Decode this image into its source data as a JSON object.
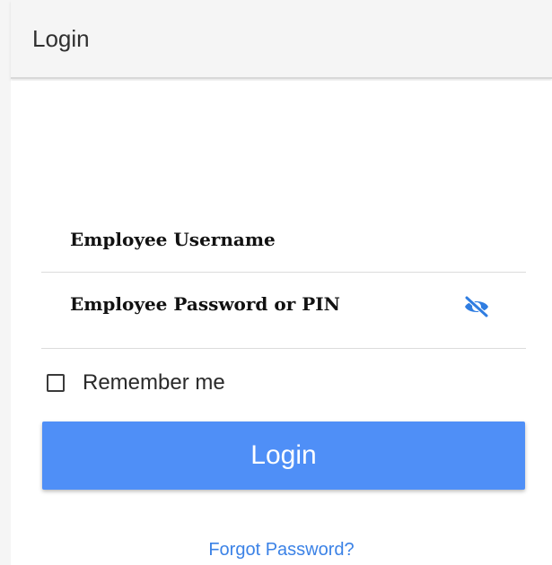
{
  "app_bar": {
    "title": "Login"
  },
  "form": {
    "username": {
      "label": "Employee Username"
    },
    "password": {
      "label": "Employee Password or PIN",
      "toggle_icon": "eye-off-icon"
    },
    "remember": {
      "label": "Remember me",
      "checked": false
    },
    "submit_label": "Login",
    "forgot_label": "Forgot Password?"
  },
  "colors": {
    "accent": "#4f8ff7",
    "link": "#3b82e6",
    "icon": "#2f7de1",
    "app_bar_bg": "#f5f5f5"
  }
}
